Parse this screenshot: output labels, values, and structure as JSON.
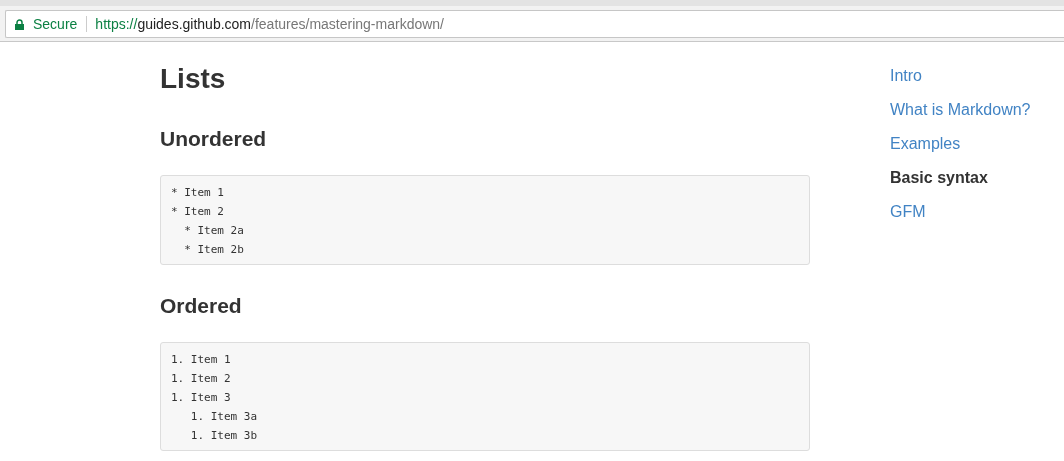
{
  "address_bar": {
    "security_label": "Secure",
    "url": {
      "scheme": "https://",
      "host": "guides.github.com",
      "path": "/features/mastering-markdown/"
    }
  },
  "content": {
    "title": "Lists",
    "sections": [
      {
        "heading": "Unordered",
        "code_lines": [
          "* Item 1",
          "* Item 2",
          "  * Item 2a",
          "  * Item 2b"
        ]
      },
      {
        "heading": "Ordered",
        "code_lines": [
          "1. Item 1",
          "1. Item 2",
          "1. Item 3",
          "   1. Item 3a",
          "   1. Item 3b"
        ]
      }
    ]
  },
  "toc": {
    "items": [
      {
        "label": "Intro",
        "selected": false
      },
      {
        "label": "What is Markdown?",
        "selected": false
      },
      {
        "label": "Examples",
        "selected": false
      },
      {
        "label": "Basic syntax",
        "selected": true
      },
      {
        "label": "GFM",
        "selected": false
      }
    ]
  }
}
